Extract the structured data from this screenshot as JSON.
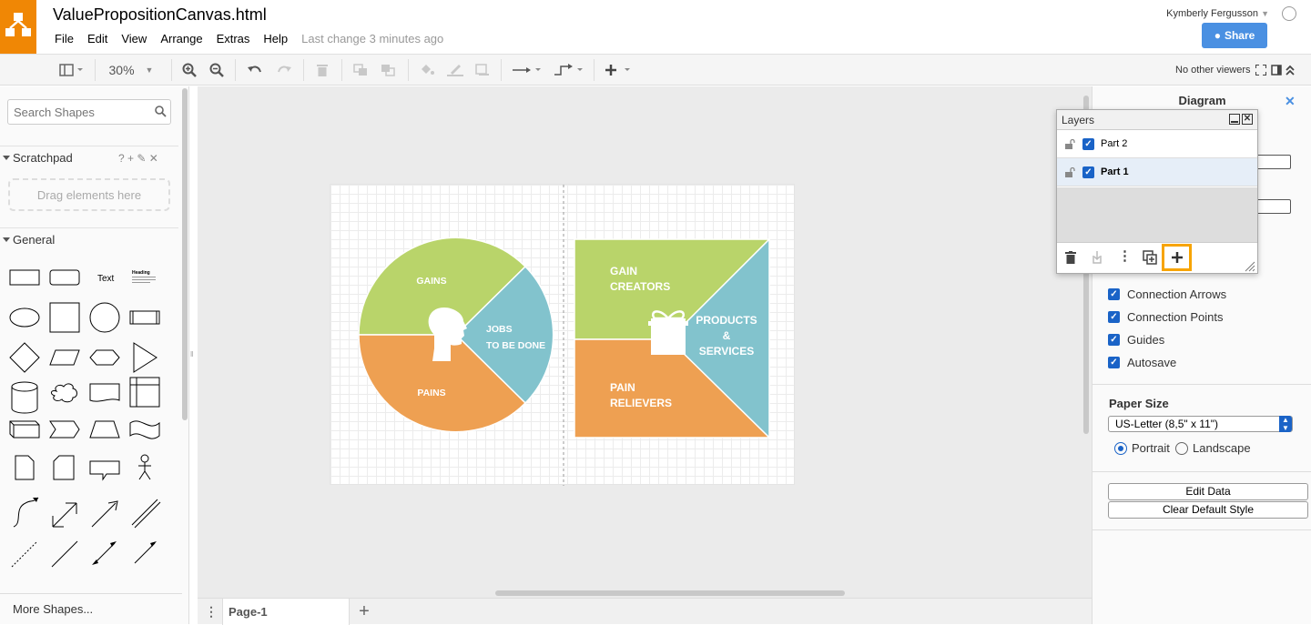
{
  "app": {
    "file_title": "ValuePropositionCanvas.html",
    "menus": [
      "File",
      "Edit",
      "View",
      "Arrange",
      "Extras",
      "Help"
    ],
    "last_change": "Last change 3 minutes ago",
    "user": "Kymberly Fergusson",
    "share_label": "Share"
  },
  "toolbar": {
    "zoom": "30%",
    "viewers": "No other viewers"
  },
  "left_panel": {
    "search_placeholder": "Search Shapes",
    "scratchpad_title": "Scratchpad",
    "scratchpad_icons": "? + ✎ ✕",
    "dropzone": "Drag elements here",
    "general_title": "General",
    "text_shape": "Text",
    "heading_shape": "Heading",
    "more_shapes": "More Shapes..."
  },
  "diagram": {
    "circle": {
      "gains": "GAINS",
      "jobs_line1": "JOBS",
      "jobs_line2": "TO BE DONE",
      "pains": "PAINS"
    },
    "square": {
      "gain_creators_line1": "GAIN",
      "gain_creators_line2": "CREATORS",
      "products_line1": "PRODUCTS",
      "products_line2": "&",
      "products_line3": "SERVICES",
      "pain_relievers_line1": "PAIN",
      "pain_relievers_line2": "RELIEVERS"
    },
    "colors": {
      "green": "#b9d46a",
      "teal": "#82c3cd",
      "orange": "#eea052"
    }
  },
  "page_tabs": {
    "current": "Page-1"
  },
  "right_panel": {
    "tab": "Diagram",
    "options": [
      "Connection Arrows",
      "Connection Points",
      "Guides",
      "Autosave"
    ],
    "paper_size_title": "Paper Size",
    "paper_size_value": "US-Letter (8,5\" x 11\")",
    "orientation": [
      "Portrait",
      "Landscape"
    ],
    "orientation_selected": "Portrait",
    "buttons": [
      "Edit Data",
      "Clear Default Style"
    ]
  },
  "layers": {
    "title": "Layers",
    "items": [
      {
        "name": "Part 2",
        "visible": true,
        "selected": false
      },
      {
        "name": "Part 1",
        "visible": true,
        "selected": true
      }
    ]
  }
}
